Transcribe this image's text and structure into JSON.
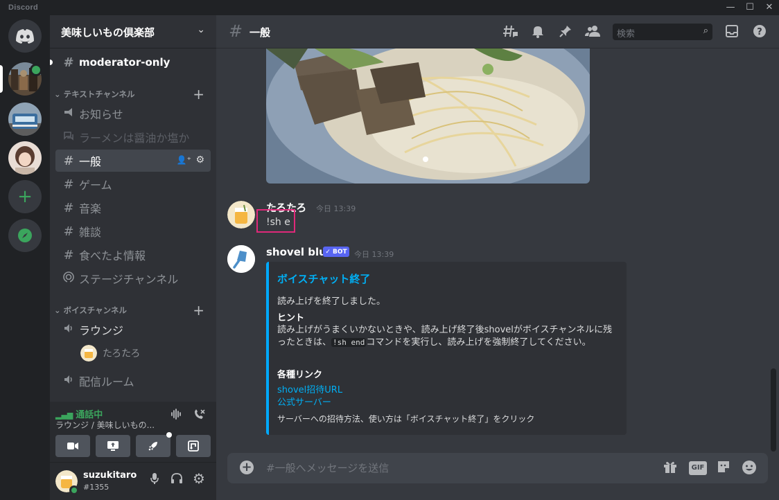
{
  "window": {
    "brand": "Discord",
    "minimize": "—",
    "maximize": "☐",
    "close": "✕"
  },
  "guild_bar": {
    "add_label": "+",
    "explore_label": "⊘"
  },
  "server": {
    "name": "美味しいもの倶楽部"
  },
  "channels": {
    "top": {
      "name": "moderator-only"
    },
    "text_category": "テキストチャンネル",
    "text": [
      {
        "name": "お知らせ",
        "glyph": "📢"
      },
      {
        "name": "ラーメンは醤油か塩か",
        "glyph": "💬"
      },
      {
        "name": "一般",
        "glyph": "#"
      },
      {
        "name": "ゲーム",
        "glyph": "#"
      },
      {
        "name": "音楽",
        "glyph": "#"
      },
      {
        "name": "雑談",
        "glyph": "#"
      },
      {
        "name": "食べたよ情報",
        "glyph": "#"
      },
      {
        "name": "ステージチャンネル",
        "glyph": "◉"
      }
    ],
    "voice_category": "ボイスチャンネル",
    "voice": [
      {
        "name": "ラウンジ"
      },
      {
        "name": "配信ルーム"
      }
    ],
    "voice_user": "たろたろ"
  },
  "voice_panel": {
    "status": "通話中",
    "sub": "ラウンジ / 美味しいもの..."
  },
  "user": {
    "name": "suzukitaro",
    "tag": "#1355"
  },
  "header": {
    "channel": "一般",
    "search_placeholder": "検索"
  },
  "messages": [
    {
      "author": "たろたろ",
      "time": "今日 13:39",
      "text": "!sh e"
    },
    {
      "author": "shovel blue",
      "badge": "✓ BOT",
      "time": "今日 13:39"
    }
  ],
  "embed": {
    "title": "ボイスチャット終了",
    "description": "読み上げを終了しました。",
    "field1_name": "ヒント",
    "field1_a": "読み上げがうまくいかないときや、読み上げ終了後shovelがボイスチャンネルに残ったときは、",
    "field1_code": "!sh end",
    "field1_b": "コマンドを実行し、読み上げを強制終了してください。",
    "field2_name": "各種リンク",
    "link1": "shovel招待URL",
    "link2": "公式サーバー",
    "footer": "サーバーへの招待方法、使い方は「ボイスチャット終了」をクリック"
  },
  "composer": {
    "placeholder": "#一般へメッセージを送信",
    "gif_label": "GIF"
  },
  "colors": {
    "accent": "#5865f2",
    "embed_bar": "#00aaff",
    "online": "#3ba55d",
    "highlight": "#e0297a"
  }
}
